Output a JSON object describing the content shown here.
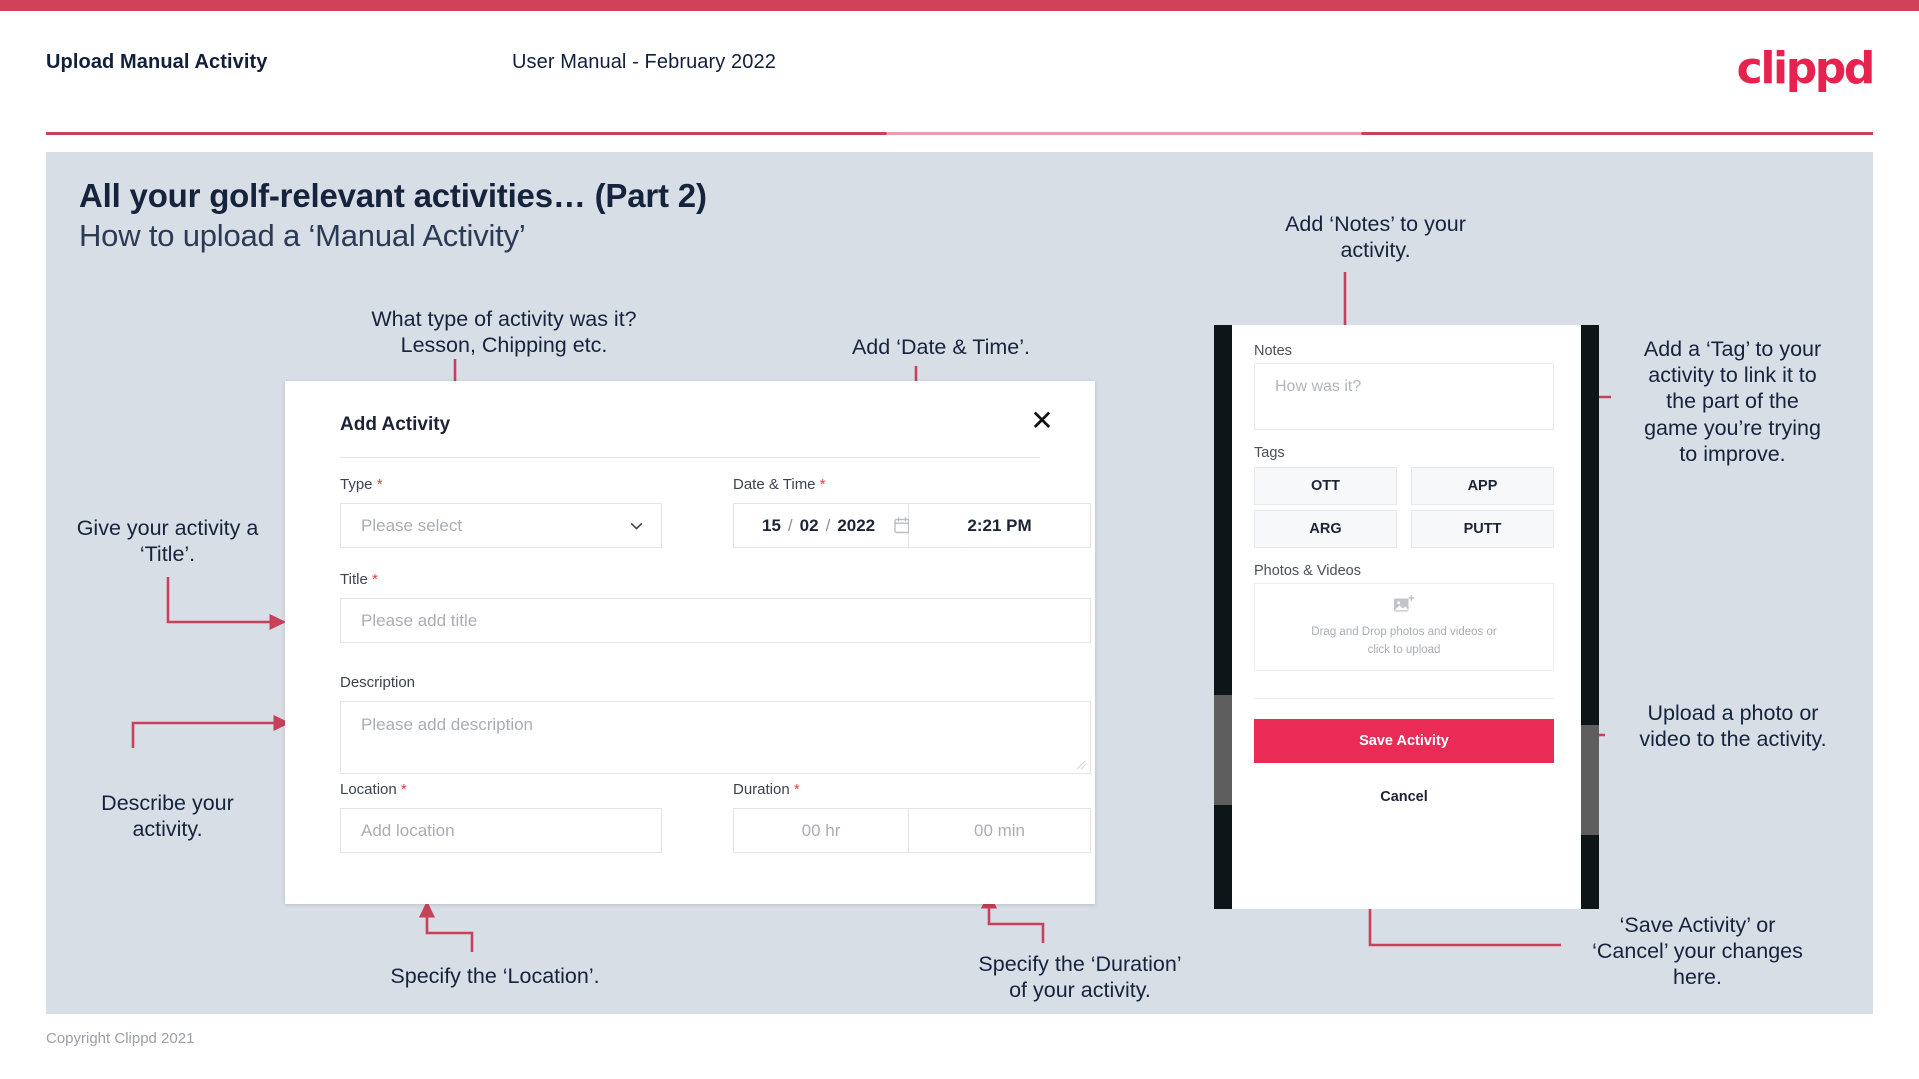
{
  "header": {
    "left_title": "Upload Manual Activity",
    "center_title": "User Manual - February 2022",
    "logo": "clippd"
  },
  "slide": {
    "title_line1": "All your golf-relevant activities… (Part 2)",
    "title_line2": "How to upload a ‘Manual Activity’",
    "copyright": "Copyright Clippd 2021"
  },
  "annotations": {
    "type": "What type of activity was it?\nLesson, Chipping etc.",
    "datetime": "Add ‘Date & Time’.",
    "title": "Give your activity a\n‘Title’.",
    "description": "Describe your\nactivity.",
    "location": "Specify the ‘Location’.",
    "duration": "Specify the ‘Duration’\nof your activity.",
    "notes": "Add ‘Notes’ to your\nactivity.",
    "tags": "Add a ‘Tag’ to your\nactivity to link it to\nthe part of the\ngame you’re trying\nto improve.",
    "upload": "Upload a photo or\nvideo to the activity.",
    "save_cancel": "‘Save Activity’ or\n‘Cancel’ your changes\nhere."
  },
  "dialog": {
    "title": "Add Activity",
    "close_icon": "close-icon",
    "fields": {
      "type": {
        "label": "Type",
        "required": "*",
        "placeholder": "Please select",
        "chevron_icon": "chevron-down-icon"
      },
      "datetime": {
        "label": "Date & Time",
        "required": "*",
        "day": "15",
        "sep1": "/",
        "month": "02",
        "sep2": "/",
        "year": "2022",
        "calendar_icon": "calendar-icon",
        "time": "2:21 PM"
      },
      "title": {
        "label": "Title",
        "required": "*",
        "placeholder": "Please add title"
      },
      "description": {
        "label": "Description",
        "required": "",
        "placeholder": "Please add description"
      },
      "location": {
        "label": "Location",
        "required": "*",
        "placeholder": "Add location"
      },
      "duration": {
        "label": "Duration",
        "required": "*",
        "hours_placeholder": "00 hr",
        "minutes_placeholder": "00 min"
      }
    }
  },
  "phone": {
    "notes": {
      "label": "Notes",
      "placeholder": "How was it?"
    },
    "tags": {
      "label": "Tags",
      "items": [
        "OTT",
        "APP",
        "ARG",
        "PUTT"
      ]
    },
    "photos": {
      "label": "Photos & Videos",
      "icon": "add-image-icon",
      "drop_line1": "Drag and Drop photos and videos or",
      "drop_line2": "click to upload"
    },
    "save_label": "Save Activity",
    "cancel_label": "Cancel"
  },
  "colors": {
    "accent": "#cf4059",
    "brand_pink": "#e8224e",
    "save_button": "#ea2b56",
    "slide_bg": "#d8dee6",
    "text_dark": "#15233c",
    "required_star": "#ec3b3b"
  }
}
